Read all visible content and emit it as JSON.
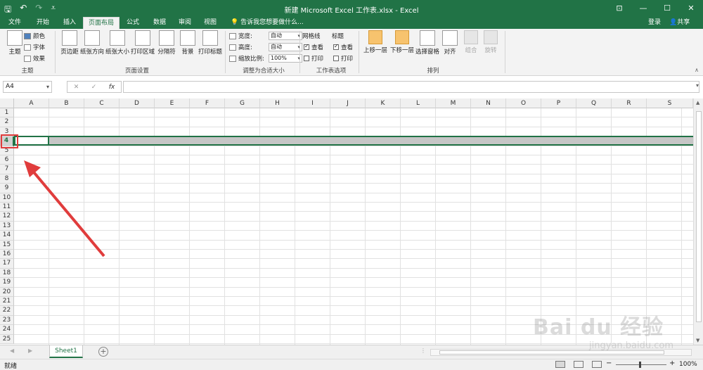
{
  "window": {
    "title": "新建 Microsoft Excel 工作表.xlsx - Excel",
    "login": "登录",
    "share": "共享",
    "controls": [
      "⊡",
      "—",
      "☐",
      "✕"
    ]
  },
  "tabs": [
    "文件",
    "开始",
    "插入",
    "页面布局",
    "公式",
    "数据",
    "审阅",
    "视图"
  ],
  "active_tab": "页面布局",
  "tell_me": "告诉我您想要做什么...",
  "ribbon": {
    "theme": {
      "label": "主题",
      "colors": "颜色",
      "fonts": "字体",
      "effects": "效果",
      "group": "主题"
    },
    "page_setup": {
      "margins": "页边距",
      "orientation": "纸张方向",
      "size": "纸张大小",
      "print_area": "打印区域",
      "breaks": "分隔符",
      "background": "背景",
      "print_titles": "打印标题",
      "group": "页面设置"
    },
    "scale": {
      "width_label": "宽度:",
      "width_value": "自动",
      "height_label": "高度:",
      "height_value": "自动",
      "scale_label": "缩放比例:",
      "scale_value": "100%",
      "group": "调整为合适大小"
    },
    "sheet_options": {
      "gridlines": "网格线",
      "headings": "标题",
      "view": "查看",
      "print": "打印",
      "gridlines_view": true,
      "gridlines_print": false,
      "headings_view": true,
      "headings_print": false,
      "group": "工作表选项"
    },
    "arrange": {
      "bring_forward": "上移一层",
      "send_backward": "下移一层",
      "selection_pane": "选择窗格",
      "align": "对齐",
      "group_btn": "组合",
      "rotate": "旋转",
      "group": "排列"
    }
  },
  "formula_bar": {
    "name_box": "A4",
    "cancel": "✕",
    "enter": "✓",
    "fx": "fx",
    "content": ""
  },
  "columns": [
    "A",
    "B",
    "C",
    "D",
    "E",
    "F",
    "G",
    "H",
    "I",
    "J",
    "K",
    "L",
    "M",
    "N",
    "O",
    "P",
    "Q",
    "R",
    "S"
  ],
  "rows": [
    "1",
    "2",
    "3",
    "4",
    "5",
    "6",
    "7",
    "8",
    "9",
    "10",
    "11",
    "12",
    "13",
    "14",
    "15",
    "16",
    "17",
    "18",
    "19",
    "20",
    "21",
    "22",
    "23",
    "24",
    "25"
  ],
  "selected_row": "4",
  "sheets": [
    "Sheet1"
  ],
  "status": {
    "ready": "就绪",
    "zoom": "100%"
  },
  "watermark": {
    "brand": "Bai du 经验",
    "url": "jingyan.baidu.com"
  },
  "colors": {
    "excel_green": "#217346",
    "highlight_red": "#e03c3c"
  }
}
